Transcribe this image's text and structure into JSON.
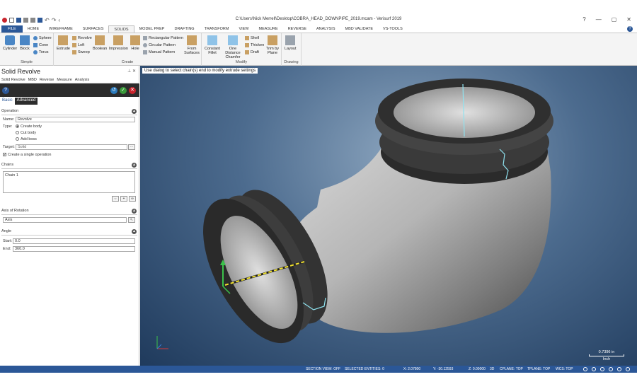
{
  "window": {
    "title": "C:\\Users\\Nick Merrell\\Desktop\\COBRA_HEAD_DOWNPIPE_2019.mcam - Verisurf 2019",
    "controls": [
      "?",
      "—",
      "▢",
      "✕"
    ]
  },
  "ribbon_tabs": [
    "FILE",
    "HOME",
    "WIREFRAME",
    "SURFACES",
    "SOLIDS",
    "MODEL PREP",
    "DRAFTING",
    "TRANSFORM",
    "VIEW",
    "MEASURE",
    "REVERSE",
    "ANALYSIS",
    "MBD VALIDATE",
    "VS-TOOLS"
  ],
  "active_tab": "SOLIDS",
  "ribbon_groups": {
    "simple": {
      "label": "Simple",
      "cylinder": "Cylinder",
      "block": "Block",
      "sphere": "Sphere",
      "cone": "Cone",
      "torus": "Torus"
    },
    "create": {
      "label": "Create",
      "extrude": "Extrude",
      "revolve": "Revolve",
      "loft": "Loft",
      "sweep": "Sweep",
      "boolean": "Boolean",
      "impression": "Impression",
      "hole": "Hole",
      "rect_pattern": "Rectangular Pattern",
      "circ_pattern": "Circular Pattern",
      "manual_pattern": "Manual Pattern",
      "from_surfaces": "From Surfaces"
    },
    "modify": {
      "label": "Modify",
      "constant_fillet": "Constant Fillet",
      "one_distance_chamfer": "One Distance Chamfer",
      "shell": "Shell",
      "thicken": "Thicken",
      "draft": "Draft",
      "trim_by_plane": "Trim by Plane"
    },
    "drawing": {
      "label": "Drawing",
      "layout": "Layout"
    }
  },
  "panel": {
    "title": "Solid Revolve",
    "tabs": [
      "Solid Revolve",
      "MBD",
      "Reverse",
      "Measure",
      "Analysis"
    ],
    "subtabs": [
      "Basic",
      "Advanced"
    ],
    "operation": {
      "header": "Operation",
      "name_label": "Name:",
      "name_value": "Revolve",
      "type_label": "Type:",
      "types": [
        "Create body",
        "Cut body",
        "Add boss"
      ],
      "selected_type": "Create body",
      "target_label": "Target:",
      "target_value": "Solid",
      "single_op": "Create a single operation"
    },
    "chains": {
      "header": "Chains",
      "items": [
        "Chain  1"
      ]
    },
    "axis": {
      "header": "Axis of Rotation",
      "value": "Axis"
    },
    "angle": {
      "header": "Angle",
      "start_label": "Start:",
      "start_value": "0.0",
      "end_label": "End:",
      "end_value": "360.0"
    }
  },
  "viewport": {
    "prompt": "Use dialog to select chain(s) end to modify extrude settings",
    "scale_value": "0.7396 in",
    "scale_unit": "Inch"
  },
  "status": {
    "section_view": "SECTION VIEW: OFF",
    "selected": "SELECTED ENTITIES: 0",
    "x": "X:   2.07800",
    "y": "Y:   -30.12593",
    "z": "Z:   0.00000",
    "mode": "3D",
    "cplane": "CPLANE: TOP",
    "tplane": "TPLANE: TOP",
    "wcs": "WCS: TOP"
  },
  "colors": {
    "accent": "#2b5797",
    "panel_bar": "#2c2c2c",
    "help": "#2b5797"
  }
}
